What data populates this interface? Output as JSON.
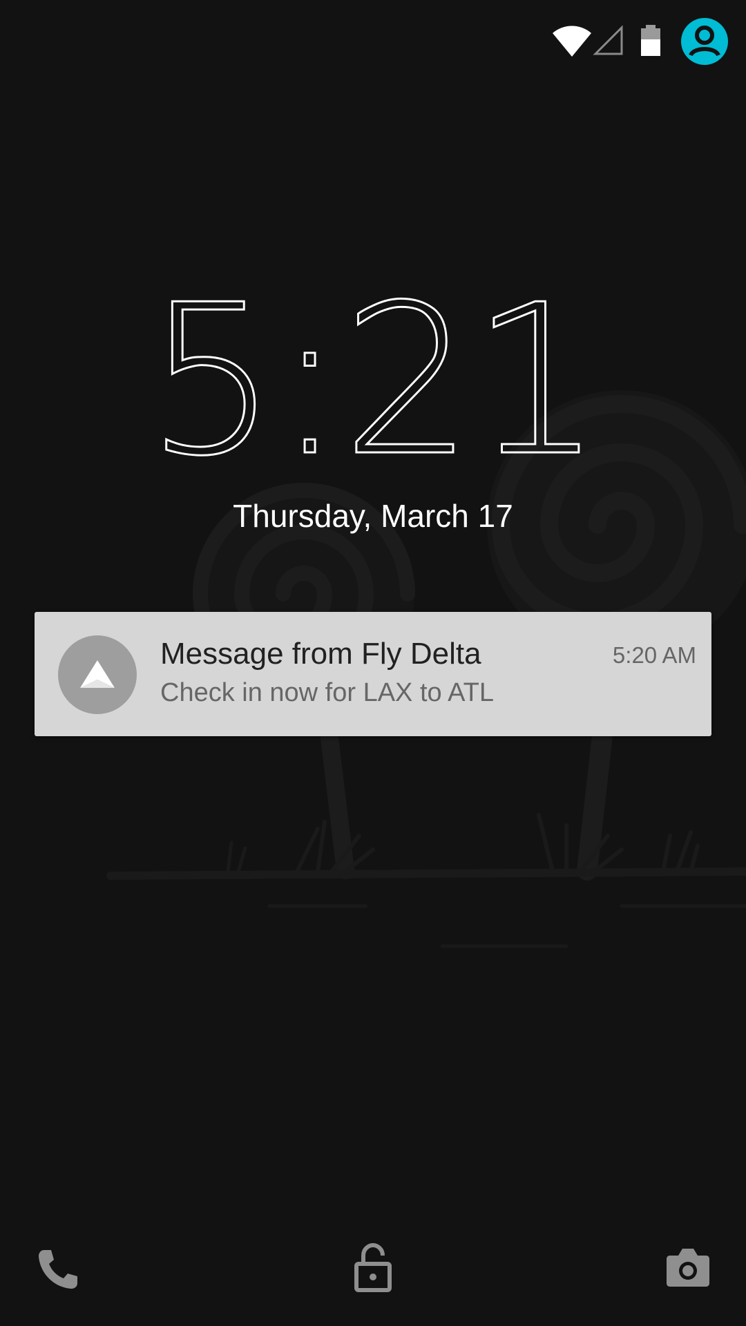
{
  "status_bar": {
    "icons": [
      "wifi-icon",
      "cellular-signal-icon",
      "battery-icon",
      "user-account-icon"
    ],
    "accent_color": "#00bcd4"
  },
  "lockscreen": {
    "time": "5:21",
    "date": "Thursday, March 17"
  },
  "notification": {
    "app_icon": "delta-logo-icon",
    "title": "Message from Fly Delta",
    "text": "Check in now for LAX to ATL",
    "time": "5:20 AM",
    "background_color": "#d6d6d6"
  },
  "bottom_actions": {
    "left_icon": "phone-icon",
    "center_icon": "lock-icon",
    "right_icon": "camera-icon"
  }
}
